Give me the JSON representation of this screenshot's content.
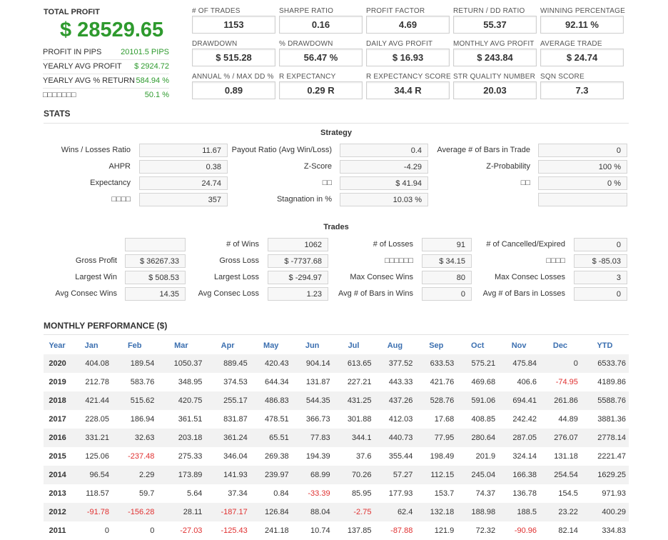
{
  "summary": {
    "total_profit_label": "TOTAL PROFIT",
    "total_profit_value": "$ 28529.65",
    "rows": [
      {
        "label": "PROFIT IN PIPS",
        "value": "20101.5 PIPS"
      },
      {
        "label": "YEARLY AVG PROFIT",
        "value": "$ 2924.72"
      },
      {
        "label": "YEARLY AVG % RETURN",
        "value": "584.94 %"
      },
      {
        "label": "□□□□□□□",
        "value": "50.1 %"
      }
    ]
  },
  "metrics": [
    {
      "label": "# OF TRADES",
      "value": "1153"
    },
    {
      "label": "SHARPE RATIO",
      "value": "0.16"
    },
    {
      "label": "PROFIT FACTOR",
      "value": "4.69"
    },
    {
      "label": "RETURN / DD RATIO",
      "value": "55.37"
    },
    {
      "label": "WINNING PERCENTAGE",
      "value": "92.11 %"
    },
    {
      "label": "DRAWDOWN",
      "value": "$ 515.28"
    },
    {
      "label": "% DRAWDOWN",
      "value": "56.47 %"
    },
    {
      "label": "DAILY AVG PROFIT",
      "value": "$ 16.93"
    },
    {
      "label": "MONTHLY AVG PROFIT",
      "value": "$ 243.84"
    },
    {
      "label": "AVERAGE TRADE",
      "value": "$ 24.74"
    },
    {
      "label": "ANNUAL % / MAX DD %",
      "value": "0.89"
    },
    {
      "label": "R EXPECTANCY",
      "value": "0.29 R"
    },
    {
      "label": "R EXPECTANCY SCORE",
      "value": "34.4 R"
    },
    {
      "label": "STR QUALITY NUMBER",
      "value": "20.03"
    },
    {
      "label": "SQN SCORE",
      "value": "7.3"
    }
  ],
  "stats_title": "STATS",
  "strategy": {
    "title": "Strategy",
    "col1": [
      {
        "label": "Wins / Losses Ratio",
        "value": "11.67"
      },
      {
        "label": "AHPR",
        "value": "0.38"
      },
      {
        "label": "Expectancy",
        "value": "24.74"
      },
      {
        "label": "□□□□",
        "value": "357"
      }
    ],
    "col2": [
      {
        "label": "Payout Ratio (Avg Win/Loss)",
        "value": "0.4"
      },
      {
        "label": "Z-Score",
        "value": "-4.29"
      },
      {
        "label": "□□",
        "value": "$ 41.94"
      },
      {
        "label": "Stagnation in %",
        "value": "10.03 %"
      }
    ],
    "col3": [
      {
        "label": "Average # of Bars in Trade",
        "value": "0"
      },
      {
        "label": "Z-Probability",
        "value": "100 %"
      },
      {
        "label": "□□",
        "value": "0 %"
      },
      {
        "label": "",
        "value": ""
      }
    ]
  },
  "trades": {
    "title": "Trades",
    "col1": [
      {
        "label": "",
        "value": ""
      },
      {
        "label": "Gross Profit",
        "value": "$ 36267.33"
      },
      {
        "label": "Largest Win",
        "value": "$ 508.53"
      },
      {
        "label": "Avg Consec Wins",
        "value": "14.35"
      }
    ],
    "col2": [
      {
        "label": "# of Wins",
        "value": "1062"
      },
      {
        "label": "Gross Loss",
        "value": "$ -7737.68"
      },
      {
        "label": "Largest Loss",
        "value": "$ -294.97"
      },
      {
        "label": "Avg Consec Loss",
        "value": "1.23"
      }
    ],
    "col3": [
      {
        "label": "# of Losses",
        "value": "91"
      },
      {
        "label": "□□□□□□",
        "value": "$ 34.15"
      },
      {
        "label": "Max Consec Wins",
        "value": "80"
      },
      {
        "label": "Avg # of Bars in Wins",
        "value": "0"
      }
    ],
    "col4": [
      {
        "label": "# of Cancelled/Expired",
        "value": "0"
      },
      {
        "label": "□□□□",
        "value": "$ -85.03"
      },
      {
        "label": "Max Consec Losses",
        "value": "3"
      },
      {
        "label": "Avg # of Bars in Losses",
        "value": "0"
      }
    ]
  },
  "monthly": {
    "title": "MONTHLY PERFORMANCE ($)",
    "headers": [
      "Year",
      "Jan",
      "Feb",
      "Mar",
      "Apr",
      "May",
      "Jun",
      "Jul",
      "Aug",
      "Sep",
      "Oct",
      "Nov",
      "Dec",
      "YTD"
    ],
    "rows": [
      [
        "2020",
        "404.08",
        "189.54",
        "1050.37",
        "889.45",
        "420.43",
        "904.14",
        "613.65",
        "377.52",
        "633.53",
        "575.21",
        "475.84",
        "0",
        "6533.76"
      ],
      [
        "2019",
        "212.78",
        "583.76",
        "348.95",
        "374.53",
        "644.34",
        "131.87",
        "227.21",
        "443.33",
        "421.76",
        "469.68",
        "406.6",
        "-74.95",
        "4189.86"
      ],
      [
        "2018",
        "421.44",
        "515.62",
        "420.75",
        "255.17",
        "486.83",
        "544.35",
        "431.25",
        "437.26",
        "528.76",
        "591.06",
        "694.41",
        "261.86",
        "5588.76"
      ],
      [
        "2017",
        "228.05",
        "186.94",
        "361.51",
        "831.87",
        "478.51",
        "366.73",
        "301.88",
        "412.03",
        "17.68",
        "408.85",
        "242.42",
        "44.89",
        "3881.36"
      ],
      [
        "2016",
        "331.21",
        "32.63",
        "203.18",
        "361.24",
        "65.51",
        "77.83",
        "344.1",
        "440.73",
        "77.95",
        "280.64",
        "287.05",
        "276.07",
        "2778.14"
      ],
      [
        "2015",
        "125.06",
        "-237.48",
        "275.33",
        "346.04",
        "269.38",
        "194.39",
        "37.6",
        "355.44",
        "198.49",
        "201.9",
        "324.14",
        "131.18",
        "2221.47"
      ],
      [
        "2014",
        "96.54",
        "2.29",
        "173.89",
        "141.93",
        "239.97",
        "68.99",
        "70.26",
        "57.27",
        "112.15",
        "245.04",
        "166.38",
        "254.54",
        "1629.25"
      ],
      [
        "2013",
        "118.57",
        "59.7",
        "5.64",
        "37.34",
        "0.84",
        "-33.39",
        "85.95",
        "177.93",
        "153.7",
        "74.37",
        "136.78",
        "154.5",
        "971.93"
      ],
      [
        "2012",
        "-91.78",
        "-156.28",
        "28.11",
        "-187.17",
        "126.84",
        "88.04",
        "-2.75",
        "62.4",
        "132.18",
        "188.98",
        "188.5",
        "23.22",
        "400.29"
      ],
      [
        "2011",
        "0",
        "0",
        "-27.03",
        "-125.43",
        "241.18",
        "10.74",
        "137.85",
        "-87.88",
        "121.9",
        "72.32",
        "-90.96",
        "82.14",
        "334.83"
      ]
    ]
  },
  "colors": {
    "profit_green": "#2e9a2e",
    "negative_red": "#e03030",
    "header_blue": "#3b6fb0"
  }
}
